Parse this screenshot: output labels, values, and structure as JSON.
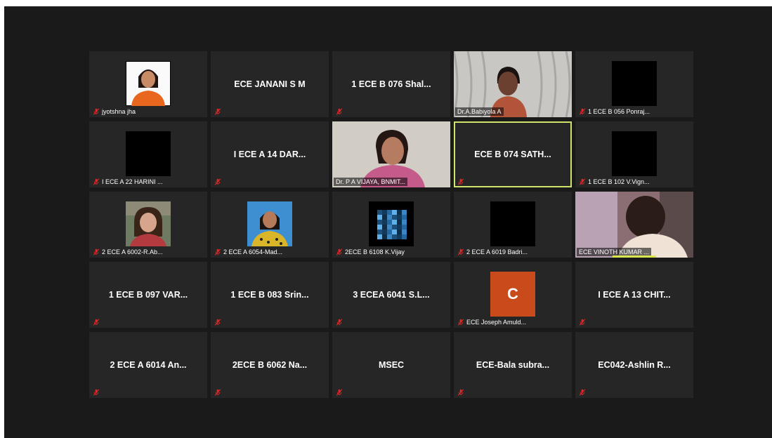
{
  "participants": [
    {
      "name": "jyotshna jha",
      "type": "photo",
      "photo": "woman-orange"
    },
    {
      "name": "ECE JANANI S M",
      "type": "name"
    },
    {
      "name": "1 ECE B 076 Shal...",
      "type": "name"
    },
    {
      "name": "Dr.A.Babiyola A",
      "type": "video",
      "video": "woman-curtain",
      "muted": false
    },
    {
      "name": "1 ECE B 056 Ponraj...",
      "type": "photo",
      "photo": "black"
    },
    {
      "name": "I ECE A 22 HARINI ...",
      "type": "photo",
      "photo": "black"
    },
    {
      "name": "I ECE A 14 DAR...",
      "type": "name"
    },
    {
      "name": "Dr. P A VIJAYA, BNMIT...",
      "type": "video",
      "video": "woman-wall",
      "muted": false
    },
    {
      "name": "ECE B 074 SATH...",
      "type": "name",
      "active": true
    },
    {
      "name": "1 ECE B 102 V.Vign...",
      "type": "photo",
      "photo": "black"
    },
    {
      "name": "2 ECE A 6002-R.Ab...",
      "type": "photo",
      "photo": "girl-selfie"
    },
    {
      "name": "2 ECE A 6054-Mad...",
      "type": "photo",
      "photo": "girl-yellow"
    },
    {
      "name": "2ECE B 6108 K.Vijay",
      "type": "photo",
      "photo": "blue-pattern"
    },
    {
      "name": "2 ECE A 6019 Badri...",
      "type": "photo",
      "photo": "black"
    },
    {
      "name": "ECE VINOTH KUMAR ...",
      "type": "video",
      "video": "man-dark",
      "muted": false,
      "speaking": true
    },
    {
      "name": "1 ECE B 097 VAR...",
      "type": "name"
    },
    {
      "name": "1 ECE B 083 Srin...",
      "type": "name"
    },
    {
      "name": "3 ECEA 6041 S.L...",
      "type": "name"
    },
    {
      "name": "ECE Joseph Amuld...",
      "type": "initial",
      "initial": "C",
      "color": "#c94a1a"
    },
    {
      "name": "I ECE A 13 CHIT...",
      "type": "name"
    },
    {
      "name": "2 ECE A 6014 An...",
      "type": "name"
    },
    {
      "name": "2ECE B 6062 Na...",
      "type": "name"
    },
    {
      "name": "MSEC",
      "type": "name"
    },
    {
      "name": "ECE-Bala subra...",
      "type": "name"
    },
    {
      "name": "EC042-Ashlin R...",
      "type": "name"
    }
  ],
  "colors": {
    "window_bg": "#1a1a1a",
    "tile_bg": "#262626",
    "active_border": "#cfe36b",
    "muted_icon": "#e02828"
  },
  "icons": {
    "muted": "muted-mic-icon"
  }
}
